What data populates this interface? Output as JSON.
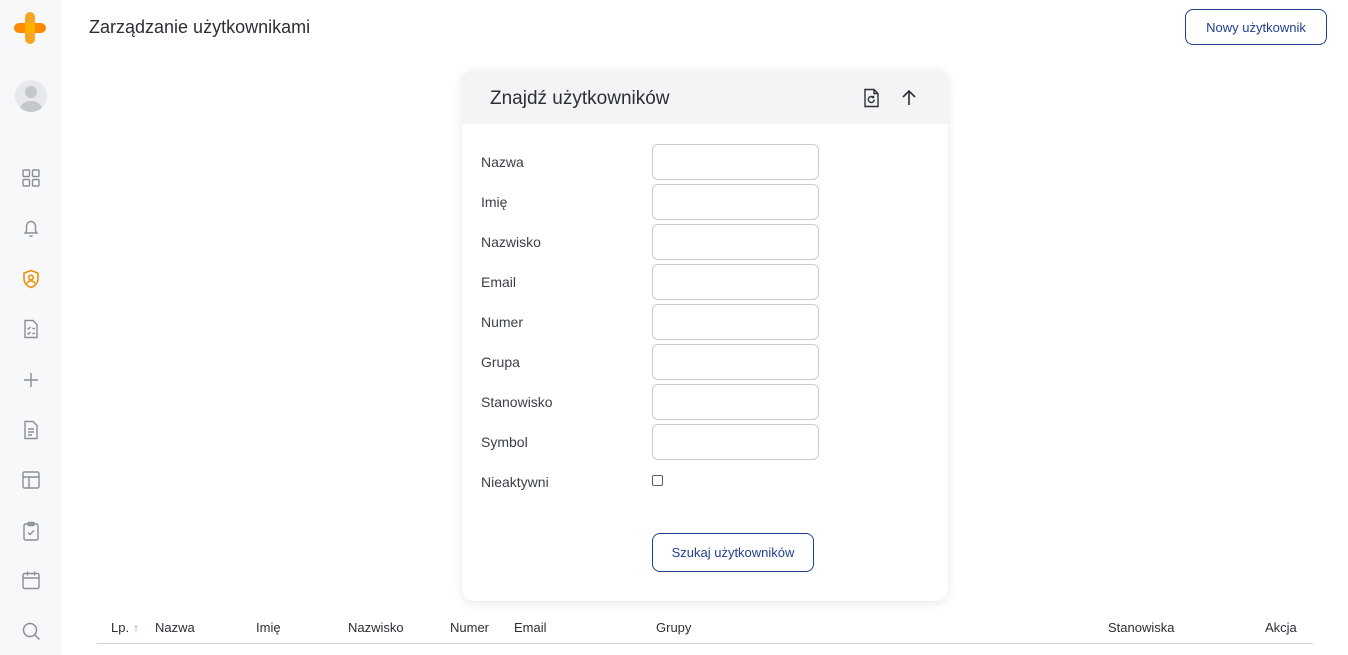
{
  "page": {
    "title": "Zarządzanie użytkownikami",
    "new_user_label": "Nowy użytkownik"
  },
  "sidebar": {
    "logo_icon": "plus-logo-icon",
    "brand_colors": [
      "#f5a623",
      "#ff7a00"
    ],
    "active_color": "#f08c00",
    "items": [
      {
        "icon": "dashboard-grid-icon"
      },
      {
        "icon": "bell-icon"
      },
      {
        "icon": "user-shield-icon",
        "active": true
      },
      {
        "icon": "checklist-document-icon"
      },
      {
        "icon": "plus-icon"
      },
      {
        "icon": "document-icon"
      },
      {
        "icon": "layout-icon"
      },
      {
        "icon": "clipboard-check-icon"
      },
      {
        "icon": "calendar-icon"
      },
      {
        "icon": "search-icon"
      }
    ]
  },
  "search_panel": {
    "title": "Znajdź użytkowników",
    "header_icons": [
      "file-refresh-icon",
      "arrow-up-icon"
    ],
    "fields": [
      {
        "label": "Nazwa",
        "value": ""
      },
      {
        "label": "Imię",
        "value": ""
      },
      {
        "label": "Nazwisko",
        "value": ""
      },
      {
        "label": "Email",
        "value": ""
      },
      {
        "label": "Numer",
        "value": ""
      },
      {
        "label": "Grupa",
        "value": ""
      },
      {
        "label": "Stanowisko",
        "value": ""
      },
      {
        "label": "Symbol",
        "value": ""
      }
    ],
    "inactive_label": "Nieaktywni",
    "inactive_checked": false,
    "search_button_label": "Szukaj użytkowników"
  },
  "table": {
    "columns": [
      "Lp.",
      "Nazwa",
      "Imię",
      "Nazwisko",
      "Numer",
      "Email",
      "Grupy",
      "Stanowiska",
      "Akcja"
    ],
    "sort_icon": "sort-arrow-up-icon",
    "sort_glyph": "↑"
  },
  "colors": {
    "accent": "#1f3f8f",
    "border": "#c9ccd1",
    "header_bg": "#f3f4f6",
    "sidebar_bg": "#f7f8fa"
  }
}
